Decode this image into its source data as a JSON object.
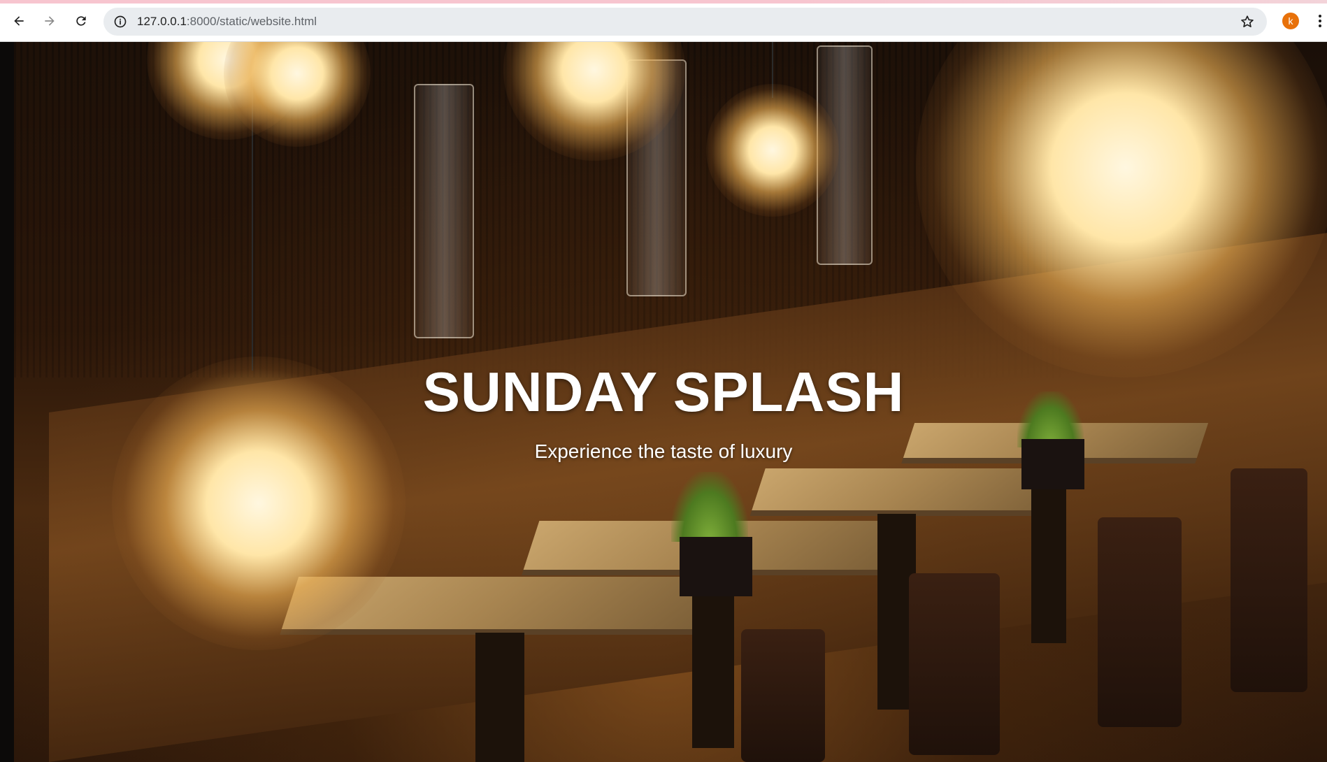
{
  "browser": {
    "url_host": "127.0.0.1",
    "url_path": ":8000/static/website.html",
    "profile_initial": "k",
    "profile_color": "#e8710a",
    "icons": {
      "back": "arrow-left-icon",
      "forward": "arrow-right-icon",
      "reload": "reload-icon",
      "site_info": "info-icon",
      "bookmark": "star-icon",
      "menu": "more-vert-icon"
    }
  },
  "hero": {
    "title": "SUNDAY SPLASH",
    "subtitle": "Experience the taste of luxury",
    "background_image": "restaurant-interior-with-pendant-lamps"
  }
}
